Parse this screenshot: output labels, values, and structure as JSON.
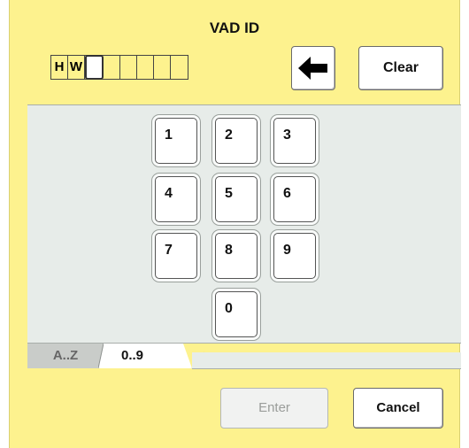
{
  "title": "VAD ID",
  "id_field": {
    "cells": [
      "H",
      "W",
      "",
      "",
      "",
      "",
      "",
      ""
    ],
    "cursor_index": 2
  },
  "toolbar": {
    "back_label": "🡐",
    "back_icon": "left-arrow-icon",
    "clear_label": "Clear"
  },
  "keypad": {
    "keys": [
      "1",
      "2",
      "3",
      "4",
      "5",
      "6",
      "7",
      "8",
      "9",
      "0"
    ]
  },
  "tabs": [
    {
      "label": "A..Z",
      "active": false
    },
    {
      "label": "0..9",
      "active": true
    }
  ],
  "footer": {
    "enter_label": "Enter",
    "enter_enabled": false,
    "cancel_label": "Cancel"
  },
  "colors": {
    "background": "#fdf28e",
    "panel": "#e7ece9",
    "disabled_text": "#9a9d9a"
  }
}
